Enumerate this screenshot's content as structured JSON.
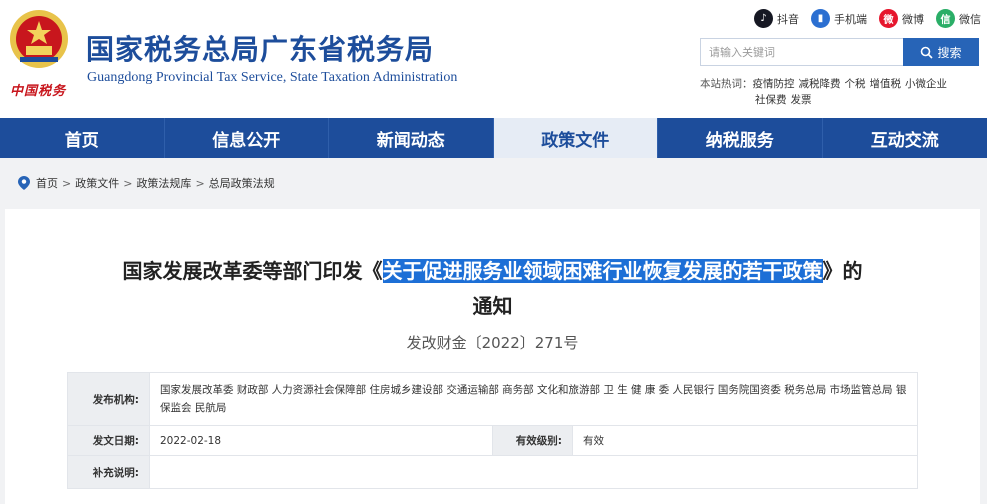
{
  "header": {
    "logo_text": "中国税务",
    "site_title": "国家税务总局广东省税务局",
    "site_subtitle": "Guangdong Provincial Tax Service, State Taxation Administration",
    "socials": [
      {
        "label": "抖音",
        "icon": "tiktok-icon",
        "glyph": "♪"
      },
      {
        "label": "手机端",
        "icon": "mobile-icon",
        "glyph": "▮"
      },
      {
        "label": "微博",
        "icon": "weibo-icon",
        "glyph": "微"
      },
      {
        "label": "微信",
        "icon": "wechat-icon",
        "glyph": "信"
      }
    ],
    "search": {
      "placeholder": "请输入关键词",
      "button_label": "搜索",
      "button_icon": "search-icon"
    },
    "hotwords": {
      "label": "本站热词：",
      "items": [
        "疫情防控",
        "减税降费",
        "个税",
        "增值税",
        "小微企业",
        "社保费",
        "发票"
      ]
    }
  },
  "nav": {
    "items": [
      {
        "label": "首页"
      },
      {
        "label": "信息公开"
      },
      {
        "label": "新闻动态"
      },
      {
        "label": "政策文件",
        "active": true
      },
      {
        "label": "纳税服务"
      },
      {
        "label": "互动交流"
      }
    ]
  },
  "breadcrumb": {
    "icon": "location-pin-icon",
    "items": [
      "首页",
      "政策文件",
      "政策法规库",
      "总局政策法规"
    ],
    "separator": ">"
  },
  "article": {
    "title_prefix": "国家发展改革委等部门印发《",
    "title_highlight": "关于促进服务业领域困难行业恢复发展的若干政策",
    "title_suffix": "》的",
    "title_line2": "通知",
    "doc_number": "发改财金〔2022〕271号",
    "meta": {
      "publisher_label": "发布机构:",
      "publisher_value": "国家发展改革委 财政部 人力资源社会保障部 住房城乡建设部 交通运输部 商务部 文化和旅游部 卫 生 健 康 委 人民银行 国务院国资委 税务总局 市场监管总局 银保监会 民航局",
      "date_label": "发文日期:",
      "date_value": "2022-02-18",
      "validity_label": "有效级别:",
      "validity_value": "有效",
      "note_label": "补充说明:",
      "note_value": ""
    }
  },
  "colors": {
    "brand_blue": "#1d4d9b",
    "search_blue": "#2764b7",
    "highlight": "#1d6fd6",
    "logo_red": "#c8161d"
  }
}
